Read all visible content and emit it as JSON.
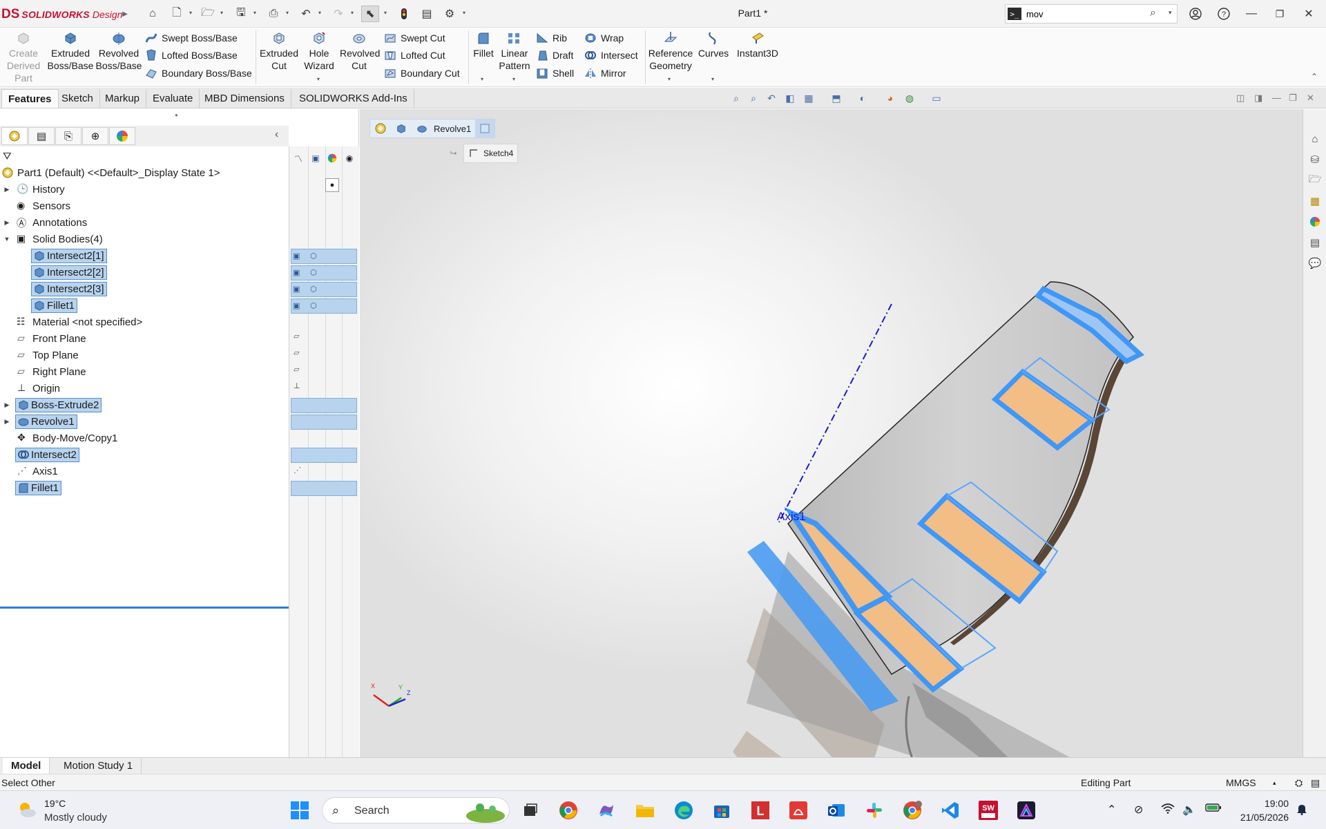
{
  "app": {
    "logo_ds": "DS",
    "logo_name": "SOLIDWORKS",
    "logo_suffix": "Design",
    "document_title": "Part1 *"
  },
  "search": {
    "value": "mov",
    "prompt_glyph": ">_"
  },
  "ribbon": {
    "create_derived_part": "Create Derived Part",
    "extruded_boss": "Extruded Boss/Base",
    "revolved_boss": "Revolved Boss/Base",
    "swept_boss": "Swept Boss/Base",
    "lofted_boss": "Lofted Boss/Base",
    "boundary_boss": "Boundary Boss/Base",
    "extruded_cut": "Extruded Cut",
    "hole_wizard": "Hole Wizard",
    "revolved_cut": "Revolved Cut",
    "swept_cut": "Swept Cut",
    "lofted_cut": "Lofted Cut",
    "boundary_cut": "Boundary Cut",
    "fillet": "Fillet",
    "linear_pattern": "Linear Pattern",
    "rib": "Rib",
    "draft": "Draft",
    "shell": "Shell",
    "wrap": "Wrap",
    "intersect": "Intersect",
    "mirror": "Mirror",
    "reference_geometry": "Reference Geometry",
    "curves": "Curves",
    "instant3d": "Instant3D"
  },
  "cm_tabs": [
    "Features",
    "Sketch",
    "Markup",
    "Evaluate",
    "MBD Dimensions",
    "SOLIDWORKS Add-Ins"
  ],
  "tree": {
    "root": "Part1 (Default) <<Default>_Display State 1>",
    "items": [
      "History",
      "Sensors",
      "Annotations",
      "Solid Bodies(4)",
      "Intersect2[1]",
      "Intersect2[2]",
      "Intersect2[3]",
      "Fillet1",
      "Material <not specified>",
      "Front Plane",
      "Top Plane",
      "Right Plane",
      "Origin",
      "Boss-Extrude2",
      "Revolve1",
      "Body-Move/Copy1",
      "Intersect2",
      "Axis1",
      "Fillet1"
    ]
  },
  "breadcrumb": {
    "feature": "Revolve1",
    "sketch": "Sketch4"
  },
  "viewport": {
    "axis_label": "Axis1",
    "colors": {
      "selection_blue": "#3f97f7",
      "face_orange": "#f3bd86",
      "body_grey": "#c9c9c9"
    }
  },
  "bottom_tabs": [
    "Model",
    "Motion Study 1"
  ],
  "status": {
    "left": "Select Other",
    "mode": "Editing Part",
    "units": "MMGS"
  },
  "taskbar": {
    "temperature": "19°C",
    "condition": "Mostly cloudy",
    "search_label": "Search",
    "time": "19:00",
    "date": "21/05/2026"
  }
}
